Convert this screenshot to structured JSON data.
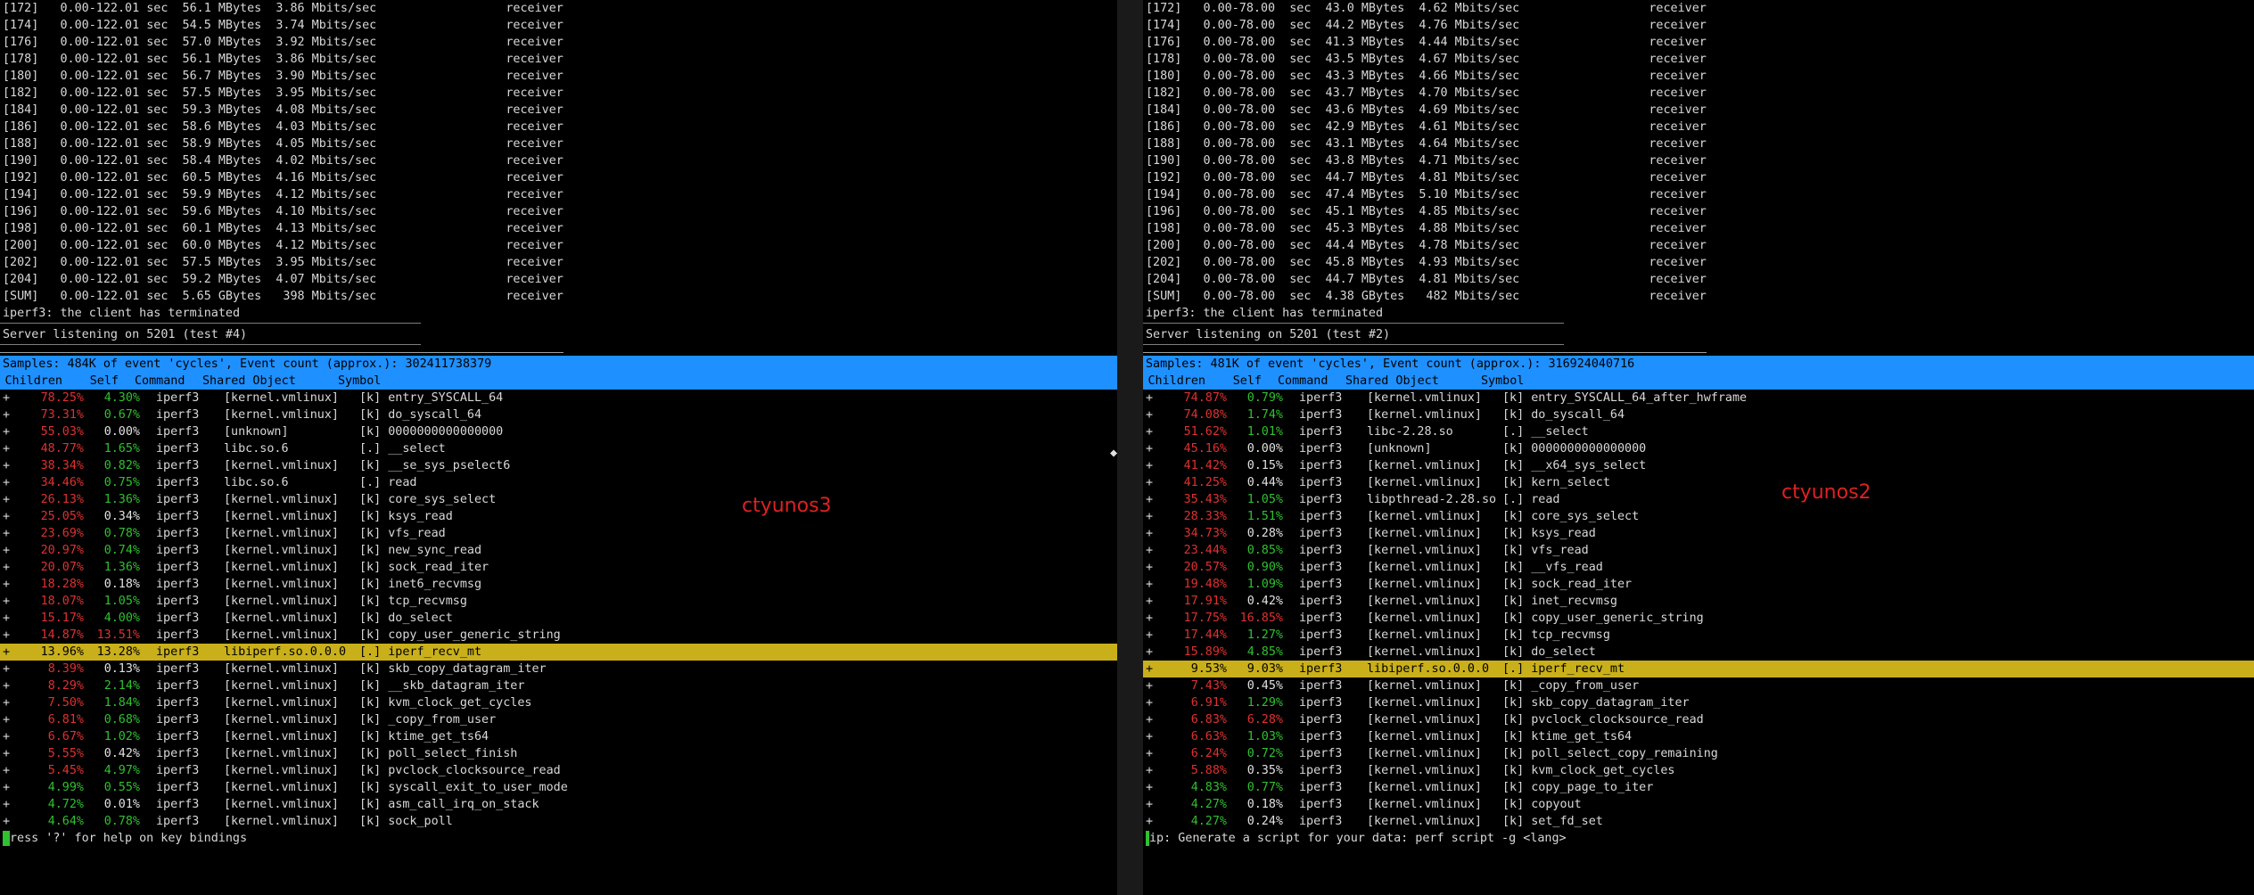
{
  "colors": {
    "bar_blue": "#1e90ff",
    "selected": "#c9b01a",
    "red": "#e03030",
    "green": "#30c030"
  },
  "left": {
    "host_label": "ctyunos3",
    "iperf_lines": [
      "[172]   0.00-122.01 sec  56.1 MBytes  3.86 Mbits/sec                  receiver",
      "[174]   0.00-122.01 sec  54.5 MBytes  3.74 Mbits/sec                  receiver",
      "[176]   0.00-122.01 sec  57.0 MBytes  3.92 Mbits/sec                  receiver",
      "[178]   0.00-122.01 sec  56.1 MBytes  3.86 Mbits/sec                  receiver",
      "[180]   0.00-122.01 sec  56.7 MBytes  3.90 Mbits/sec                  receiver",
      "[182]   0.00-122.01 sec  57.5 MBytes  3.95 Mbits/sec                  receiver",
      "[184]   0.00-122.01 sec  59.3 MBytes  4.08 Mbits/sec                  receiver",
      "[186]   0.00-122.01 sec  58.6 MBytes  4.03 Mbits/sec                  receiver",
      "[188]   0.00-122.01 sec  58.9 MBytes  4.05 Mbits/sec                  receiver",
      "[190]   0.00-122.01 sec  58.4 MBytes  4.02 Mbits/sec                  receiver",
      "[192]   0.00-122.01 sec  60.5 MBytes  4.16 Mbits/sec                  receiver",
      "[194]   0.00-122.01 sec  59.9 MBytes  4.12 Mbits/sec                  receiver",
      "[196]   0.00-122.01 sec  59.6 MBytes  4.10 Mbits/sec                  receiver",
      "[198]   0.00-122.01 sec  60.1 MBytes  4.13 Mbits/sec                  receiver",
      "[200]   0.00-122.01 sec  60.0 MBytes  4.12 Mbits/sec                  receiver",
      "[202]   0.00-122.01 sec  57.5 MBytes  3.95 Mbits/sec                  receiver",
      "[204]   0.00-122.01 sec  59.2 MBytes  4.07 Mbits/sec                  receiver",
      "[SUM]   0.00-122.01 sec  5.65 GBytes   398 Mbits/sec                  receiver",
      "iperf3: the client has terminated"
    ],
    "separator": "-----------------------------------------------------------",
    "server_line": "Server listening on 5201 (test #4)",
    "samples_line": "Samples: 484K of event 'cycles', Event count (approx.): 302411738379",
    "header": {
      "children": "Children",
      "self": "Self",
      "command": "Command",
      "shared_object": "Shared Object",
      "symbol": "Symbol"
    },
    "rows": [
      {
        "children": "78.25%",
        "self": "4.30%",
        "cc": "red",
        "sc": "green",
        "cmd": "iperf3",
        "obj": "[kernel.vmlinux]",
        "sym": "[k] entry_SYSCALL_64"
      },
      {
        "children": "73.31%",
        "self": "0.67%",
        "cc": "red",
        "sc": "green",
        "cmd": "iperf3",
        "obj": "[kernel.vmlinux]",
        "sym": "[k] do_syscall_64"
      },
      {
        "children": "55.03%",
        "self": "0.00%",
        "cc": "red",
        "sc": "white",
        "cmd": "iperf3",
        "obj": "[unknown]",
        "sym": "[k] 0000000000000000"
      },
      {
        "children": "48.77%",
        "self": "1.65%",
        "cc": "red",
        "sc": "green",
        "cmd": "iperf3",
        "obj": "libc.so.6",
        "sym": "[.] __select"
      },
      {
        "children": "38.34%",
        "self": "0.82%",
        "cc": "red",
        "sc": "green",
        "cmd": "iperf3",
        "obj": "[kernel.vmlinux]",
        "sym": "[k] __se_sys_pselect6"
      },
      {
        "children": "34.46%",
        "self": "0.75%",
        "cc": "red",
        "sc": "green",
        "cmd": "iperf3",
        "obj": "libc.so.6",
        "sym": "[.] read"
      },
      {
        "children": "26.13%",
        "self": "1.36%",
        "cc": "red",
        "sc": "green",
        "cmd": "iperf3",
        "obj": "[kernel.vmlinux]",
        "sym": "[k] core_sys_select"
      },
      {
        "children": "25.05%",
        "self": "0.34%",
        "cc": "red",
        "sc": "white",
        "cmd": "iperf3",
        "obj": "[kernel.vmlinux]",
        "sym": "[k] ksys_read"
      },
      {
        "children": "23.69%",
        "self": "0.78%",
        "cc": "red",
        "sc": "green",
        "cmd": "iperf3",
        "obj": "[kernel.vmlinux]",
        "sym": "[k] vfs_read"
      },
      {
        "children": "20.97%",
        "self": "0.74%",
        "cc": "red",
        "sc": "green",
        "cmd": "iperf3",
        "obj": "[kernel.vmlinux]",
        "sym": "[k] new_sync_read"
      },
      {
        "children": "20.07%",
        "self": "1.36%",
        "cc": "red",
        "sc": "green",
        "cmd": "iperf3",
        "obj": "[kernel.vmlinux]",
        "sym": "[k] sock_read_iter"
      },
      {
        "children": "18.28%",
        "self": "0.18%",
        "cc": "red",
        "sc": "white",
        "cmd": "iperf3",
        "obj": "[kernel.vmlinux]",
        "sym": "[k] inet6_recvmsg"
      },
      {
        "children": "18.07%",
        "self": "1.05%",
        "cc": "red",
        "sc": "green",
        "cmd": "iperf3",
        "obj": "[kernel.vmlinux]",
        "sym": "[k] tcp_recvmsg"
      },
      {
        "children": "15.17%",
        "self": "4.00%",
        "cc": "red",
        "sc": "green",
        "cmd": "iperf3",
        "obj": "[kernel.vmlinux]",
        "sym": "[k] do_select"
      },
      {
        "children": "14.87%",
        "self": "13.51%",
        "cc": "red",
        "sc": "red",
        "cmd": "iperf3",
        "obj": "[kernel.vmlinux]",
        "sym": "[k] copy_user_generic_string"
      },
      {
        "children": "13.96%",
        "self": "13.28%",
        "cc": "red",
        "sc": "red",
        "cmd": "iperf3",
        "obj": "libiperf.so.0.0.0",
        "sym": "[.] iperf_recv_mt",
        "selected": true
      },
      {
        "children": "8.39%",
        "self": "0.13%",
        "cc": "red",
        "sc": "white",
        "cmd": "iperf3",
        "obj": "[kernel.vmlinux]",
        "sym": "[k] skb_copy_datagram_iter"
      },
      {
        "children": "8.29%",
        "self": "2.14%",
        "cc": "red",
        "sc": "green",
        "cmd": "iperf3",
        "obj": "[kernel.vmlinux]",
        "sym": "[k] __skb_datagram_iter"
      },
      {
        "children": "7.50%",
        "self": "1.84%",
        "cc": "red",
        "sc": "green",
        "cmd": "iperf3",
        "obj": "[kernel.vmlinux]",
        "sym": "[k] kvm_clock_get_cycles"
      },
      {
        "children": "6.81%",
        "self": "0.68%",
        "cc": "red",
        "sc": "green",
        "cmd": "iperf3",
        "obj": "[kernel.vmlinux]",
        "sym": "[k] _copy_from_user"
      },
      {
        "children": "6.67%",
        "self": "1.02%",
        "cc": "red",
        "sc": "green",
        "cmd": "iperf3",
        "obj": "[kernel.vmlinux]",
        "sym": "[k] ktime_get_ts64"
      },
      {
        "children": "5.55%",
        "self": "0.42%",
        "cc": "red",
        "sc": "white",
        "cmd": "iperf3",
        "obj": "[kernel.vmlinux]",
        "sym": "[k] poll_select_finish"
      },
      {
        "children": "5.45%",
        "self": "4.97%",
        "cc": "red",
        "sc": "green",
        "cmd": "iperf3",
        "obj": "[kernel.vmlinux]",
        "sym": "[k] pvclock_clocksource_read"
      },
      {
        "children": "4.99%",
        "self": "0.55%",
        "cc": "green",
        "sc": "green",
        "cmd": "iperf3",
        "obj": "[kernel.vmlinux]",
        "sym": "[k] syscall_exit_to_user_mode"
      },
      {
        "children": "4.72%",
        "self": "0.01%",
        "cc": "green",
        "sc": "white",
        "cmd": "iperf3",
        "obj": "[kernel.vmlinux]",
        "sym": "[k] asm_call_irq_on_stack"
      },
      {
        "children": "4.64%",
        "self": "0.78%",
        "cc": "green",
        "sc": "green",
        "cmd": "iperf3",
        "obj": "[kernel.vmlinux]",
        "sym": "[k] sock_poll"
      }
    ],
    "status_line": "ress '?' for help on key bindings"
  },
  "right": {
    "host_label": "ctyunos2",
    "iperf_lines": [
      "[172]   0.00-78.00  sec  43.0 MBytes  4.62 Mbits/sec                  receiver",
      "[174]   0.00-78.00  sec  44.2 MBytes  4.76 Mbits/sec                  receiver",
      "[176]   0.00-78.00  sec  41.3 MBytes  4.44 Mbits/sec                  receiver",
      "[178]   0.00-78.00  sec  43.5 MBytes  4.67 Mbits/sec                  receiver",
      "[180]   0.00-78.00  sec  43.3 MBytes  4.66 Mbits/sec                  receiver",
      "[182]   0.00-78.00  sec  43.7 MBytes  4.70 Mbits/sec                  receiver",
      "[184]   0.00-78.00  sec  43.6 MBytes  4.69 Mbits/sec                  receiver",
      "[186]   0.00-78.00  sec  42.9 MBytes  4.61 Mbits/sec                  receiver",
      "[188]   0.00-78.00  sec  43.1 MBytes  4.64 Mbits/sec                  receiver",
      "[190]   0.00-78.00  sec  43.8 MBytes  4.71 Mbits/sec                  receiver",
      "[192]   0.00-78.00  sec  44.7 MBytes  4.81 Mbits/sec                  receiver",
      "[194]   0.00-78.00  sec  47.4 MBytes  5.10 Mbits/sec                  receiver",
      "[196]   0.00-78.00  sec  45.1 MBytes  4.85 Mbits/sec                  receiver",
      "[198]   0.00-78.00  sec  45.3 MBytes  4.88 Mbits/sec                  receiver",
      "[200]   0.00-78.00  sec  44.4 MBytes  4.78 Mbits/sec                  receiver",
      "[202]   0.00-78.00  sec  45.8 MBytes  4.93 Mbits/sec                  receiver",
      "[204]   0.00-78.00  sec  44.7 MBytes  4.81 Mbits/sec                  receiver",
      "[SUM]   0.00-78.00  sec  4.38 GBytes   482 Mbits/sec                  receiver",
      "iperf3: the client has terminated"
    ],
    "separator": "-----------------------------------------------------------",
    "server_line": "Server listening on 5201 (test #2)",
    "samples_line": "Samples: 481K of event 'cycles', Event count (approx.): 316924040716",
    "header": {
      "children": "Children",
      "self": "Self",
      "command": "Command",
      "shared_object": "Shared Object",
      "symbol": "Symbol"
    },
    "rows": [
      {
        "children": "74.87%",
        "self": "0.79%",
        "cc": "red",
        "sc": "green",
        "cmd": "iperf3",
        "obj": "[kernel.vmlinux]",
        "sym": "[k] entry_SYSCALL_64_after_hwframe"
      },
      {
        "children": "74.08%",
        "self": "1.74%",
        "cc": "red",
        "sc": "green",
        "cmd": "iperf3",
        "obj": "[kernel.vmlinux]",
        "sym": "[k] do_syscall_64"
      },
      {
        "children": "51.62%",
        "self": "1.01%",
        "cc": "red",
        "sc": "green",
        "cmd": "iperf3",
        "obj": "libc-2.28.so",
        "sym": "[.] __select"
      },
      {
        "children": "45.16%",
        "self": "0.00%",
        "cc": "red",
        "sc": "white",
        "cmd": "iperf3",
        "obj": "[unknown]",
        "sym": "[k] 0000000000000000"
      },
      {
        "children": "41.42%",
        "self": "0.15%",
        "cc": "red",
        "sc": "white",
        "cmd": "iperf3",
        "obj": "[kernel.vmlinux]",
        "sym": "[k] __x64_sys_select"
      },
      {
        "children": "41.25%",
        "self": "0.44%",
        "cc": "red",
        "sc": "white",
        "cmd": "iperf3",
        "obj": "[kernel.vmlinux]",
        "sym": "[k] kern_select"
      },
      {
        "children": "35.43%",
        "self": "1.05%",
        "cc": "red",
        "sc": "green",
        "cmd": "iperf3",
        "obj": "libpthread-2.28.so",
        "sym": "[.] read"
      },
      {
        "children": "28.33%",
        "self": "1.51%",
        "cc": "red",
        "sc": "green",
        "cmd": "iperf3",
        "obj": "[kernel.vmlinux]",
        "sym": "[k] core_sys_select"
      },
      {
        "children": "34.73%",
        "self": "0.28%",
        "cc": "red",
        "sc": "white",
        "cmd": "iperf3",
        "obj": "[kernel.vmlinux]",
        "sym": "[k] ksys_read"
      },
      {
        "children": "23.44%",
        "self": "0.85%",
        "cc": "red",
        "sc": "green",
        "cmd": "iperf3",
        "obj": "[kernel.vmlinux]",
        "sym": "[k] vfs_read"
      },
      {
        "children": "20.57%",
        "self": "0.90%",
        "cc": "red",
        "sc": "green",
        "cmd": "iperf3",
        "obj": "[kernel.vmlinux]",
        "sym": "[k] __vfs_read"
      },
      {
        "children": "19.48%",
        "self": "1.09%",
        "cc": "red",
        "sc": "green",
        "cmd": "iperf3",
        "obj": "[kernel.vmlinux]",
        "sym": "[k] sock_read_iter"
      },
      {
        "children": "17.91%",
        "self": "0.42%",
        "cc": "red",
        "sc": "white",
        "cmd": "iperf3",
        "obj": "[kernel.vmlinux]",
        "sym": "[k] inet_recvmsg"
      },
      {
        "children": "17.75%",
        "self": "16.85%",
        "cc": "red",
        "sc": "red",
        "cmd": "iperf3",
        "obj": "[kernel.vmlinux]",
        "sym": "[k] copy_user_generic_string"
      },
      {
        "children": "17.44%",
        "self": "1.27%",
        "cc": "red",
        "sc": "green",
        "cmd": "iperf3",
        "obj": "[kernel.vmlinux]",
        "sym": "[k] tcp_recvmsg"
      },
      {
        "children": "15.89%",
        "self": "4.85%",
        "cc": "red",
        "sc": "green",
        "cmd": "iperf3",
        "obj": "[kernel.vmlinux]",
        "sym": "[k] do_select"
      },
      {
        "children": "9.53%",
        "self": "9.03%",
        "cc": "red",
        "sc": "red",
        "cmd": "iperf3",
        "obj": "libiperf.so.0.0.0",
        "sym": "[.] iperf_recv_mt",
        "selected": true
      },
      {
        "children": "7.43%",
        "self": "0.45%",
        "cc": "red",
        "sc": "white",
        "cmd": "iperf3",
        "obj": "[kernel.vmlinux]",
        "sym": "[k] _copy_from_user"
      },
      {
        "children": "6.91%",
        "self": "1.29%",
        "cc": "red",
        "sc": "green",
        "cmd": "iperf3",
        "obj": "[kernel.vmlinux]",
        "sym": "[k] skb_copy_datagram_iter"
      },
      {
        "children": "6.83%",
        "self": "6.28%",
        "cc": "red",
        "sc": "red",
        "cmd": "iperf3",
        "obj": "[kernel.vmlinux]",
        "sym": "[k] pvclock_clocksource_read"
      },
      {
        "children": "6.63%",
        "self": "1.03%",
        "cc": "red",
        "sc": "green",
        "cmd": "iperf3",
        "obj": "[kernel.vmlinux]",
        "sym": "[k] ktime_get_ts64"
      },
      {
        "children": "6.24%",
        "self": "0.72%",
        "cc": "red",
        "sc": "green",
        "cmd": "iperf3",
        "obj": "[kernel.vmlinux]",
        "sym": "[k] poll_select_copy_remaining"
      },
      {
        "children": "5.88%",
        "self": "0.35%",
        "cc": "red",
        "sc": "white",
        "cmd": "iperf3",
        "obj": "[kernel.vmlinux]",
        "sym": "[k] kvm_clock_get_cycles"
      },
      {
        "children": "4.83%",
        "self": "0.77%",
        "cc": "green",
        "sc": "green",
        "cmd": "iperf3",
        "obj": "[kernel.vmlinux]",
        "sym": "[k] copy_page_to_iter"
      },
      {
        "children": "4.27%",
        "self": "0.18%",
        "cc": "green",
        "sc": "white",
        "cmd": "iperf3",
        "obj": "[kernel.vmlinux]",
        "sym": "[k] copyout"
      },
      {
        "children": "4.27%",
        "self": "0.24%",
        "cc": "green",
        "sc": "white",
        "cmd": "iperf3",
        "obj": "[kernel.vmlinux]",
        "sym": "[k] set_fd_set"
      }
    ],
    "status_line": "ip: Generate a script for your data: perf script -g <lang>"
  }
}
